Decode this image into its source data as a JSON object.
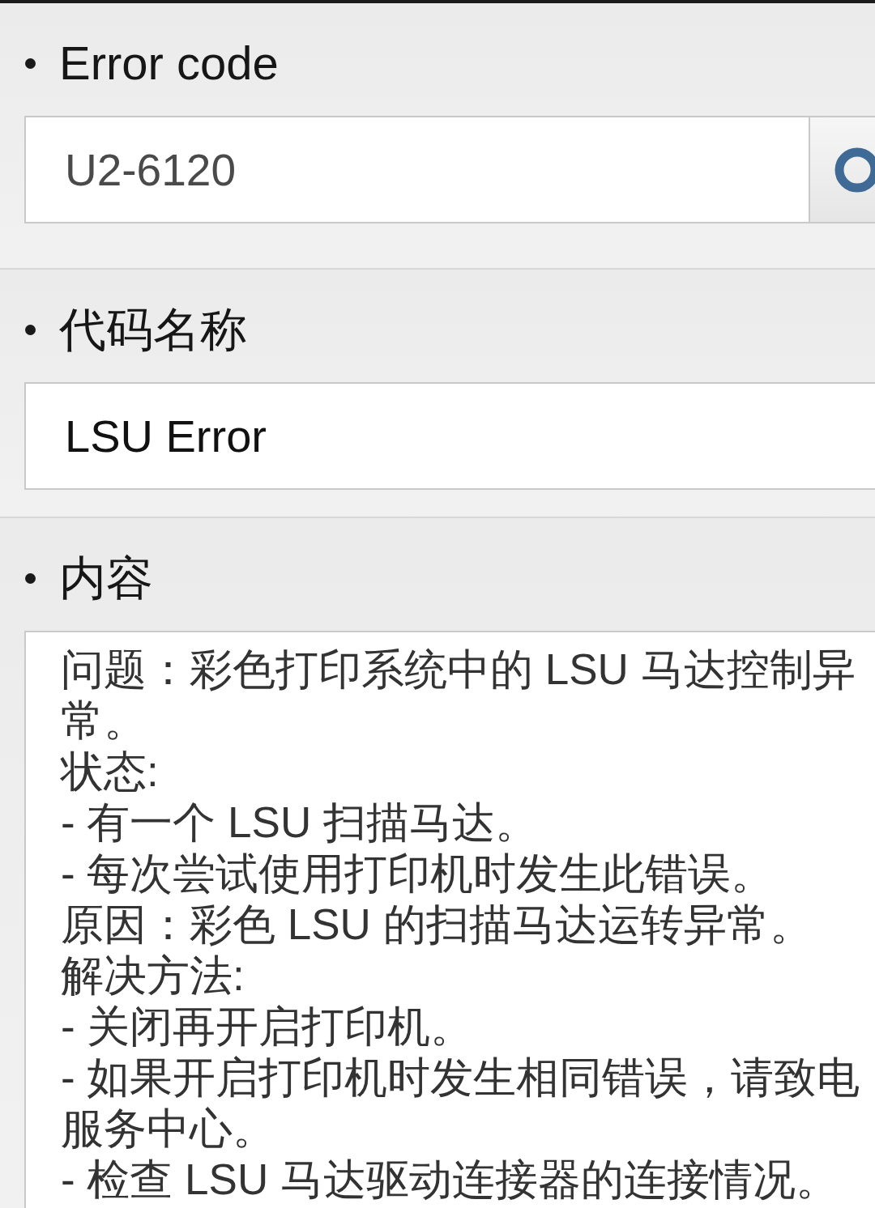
{
  "sections": [
    {
      "kind": "search",
      "label": "Error code",
      "value": "U2-6120"
    },
    {
      "kind": "text",
      "label": "代码名称",
      "value": "LSU Error"
    },
    {
      "kind": "textarea",
      "label": "内容",
      "lines": [
        "问题：彩色打印系统中的 LSU 马达控制异常。",
        "状态:",
        "- 有一个 LSU 扫描马达。",
        "- 每次尝试使用打印机时发生此错误。",
        "原因：彩色 LSU 的扫描马达运转异常。",
        "解决方法:",
        "- 关闭再开启打印机。",
        "- 如果开启打印机时发生相同错误，请致电服务中心。",
        "- 检查 LSU 马达驱动连接器的连接情况。"
      ]
    }
  ]
}
